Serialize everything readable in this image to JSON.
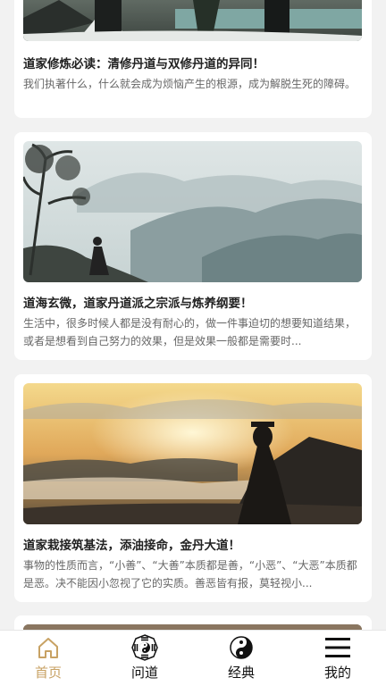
{
  "articles": [
    {
      "title": "道家修炼必读：清修丹道与双修丹道的异同！",
      "summary": "我们执著什么，什么就会成为烦恼产生的根源，成为解脱生死的障碍。"
    },
    {
      "title": "道海玄微，道家丹道派之宗派与炼养纲要！",
      "summary": "生活中，很多时候人都是没有耐心的，做一件事迫切的想要知道结果，或者是想看到自己努力的效果，但是效果一般都是需要时..."
    },
    {
      "title": "道家栽接筑基法，添油接命，金丹大道！",
      "summary": "事物的性质而言，“小善”、“大善”本质都是善，“小恶”、“大恶”本质都是恶。决不能因小忽视了它的实质。善恶皆有报，莫轻视小..."
    }
  ],
  "tabbar": {
    "items": [
      {
        "label": "首页",
        "icon": "home-icon",
        "active": true
      },
      {
        "label": "问道",
        "icon": "bagua-icon",
        "active": false
      },
      {
        "label": "经典",
        "icon": "yinyang-icon",
        "active": false
      },
      {
        "label": "我的",
        "icon": "menu-icon",
        "active": false
      }
    ],
    "active_color": "#c8a264"
  }
}
